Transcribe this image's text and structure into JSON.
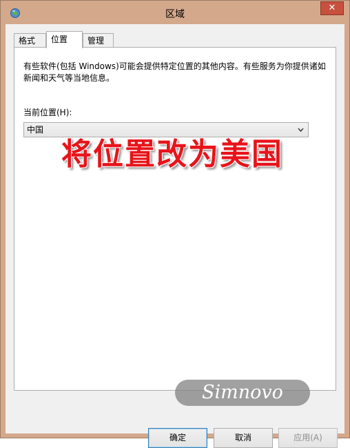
{
  "window": {
    "title": "区域",
    "close_glyph": "✕"
  },
  "tabs": [
    {
      "label": "格式",
      "active": false
    },
    {
      "label": "位置",
      "active": true
    },
    {
      "label": "管理",
      "active": false
    }
  ],
  "location": {
    "description": "有些软件(包括 Windows)可能会提供特定位置的其他内容。有些服务为你提供诸如新闻和天气等当地信息。",
    "current_label": "当前位置(H):",
    "current_value": "中国"
  },
  "overlay": {
    "annotation": "将位置改为美国",
    "watermark": "Simnovo"
  },
  "buttons": {
    "ok": "确定",
    "cancel": "取消",
    "apply": "应用(A)"
  },
  "colors": {
    "frame": "#d4a88b",
    "close_button": "#c7503f",
    "annotation": "#e8141b"
  },
  "icons": {
    "app": "region-globe-icon",
    "close": "close-icon",
    "dropdown": "chevron-down-icon"
  }
}
